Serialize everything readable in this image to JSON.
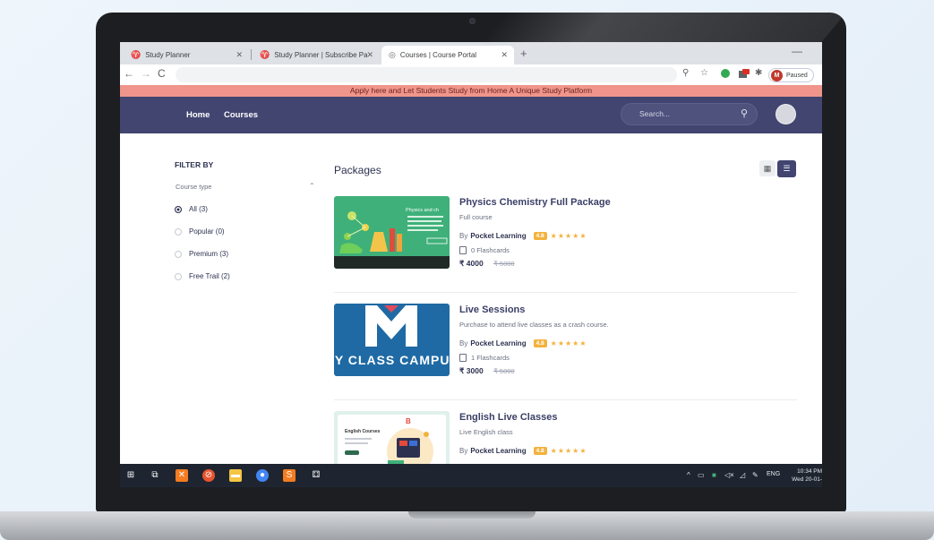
{
  "browser": {
    "tabs": [
      {
        "title": "Study Planner",
        "icon": "study-planner-icon"
      },
      {
        "title": "Study Planner | Subscribe Packag",
        "icon": "study-planner-icon"
      },
      {
        "title": "Courses | Course Portal",
        "icon": "globe-icon"
      }
    ],
    "profile": {
      "initial": "M",
      "status": "Paused"
    }
  },
  "site": {
    "announcement": "Apply here and Let Students Study from Home A Unique Study Platform",
    "nav": {
      "home": "Home",
      "courses": "Courses"
    },
    "search_placeholder": "Search..."
  },
  "filter": {
    "title": "FILTER BY",
    "group": "Course type",
    "options": [
      {
        "label": "All (3)",
        "selected": true
      },
      {
        "label": "Popular (0)",
        "selected": false
      },
      {
        "label": "Premium (3)",
        "selected": false
      },
      {
        "label": "Free Trail (2)",
        "selected": false
      }
    ]
  },
  "packages": {
    "title": "Packages",
    "items": [
      {
        "title": "Physics Chemistry Full Package",
        "subtitle": "Full course",
        "by": "By",
        "author": "Pocket Learning",
        "rating": "4.8",
        "flashcards": "0 Flashcards",
        "price": "₹ 4000",
        "old_price": "₹ 5000",
        "thumb_text": "Physics and ch"
      },
      {
        "title": "Live Sessions",
        "subtitle": "Purchase to attend live classes as a crash course.",
        "by": "By",
        "author": "Pocket Learning",
        "rating": "4.8",
        "flashcards": "1 Flashcards",
        "price": "₹ 3000",
        "old_price": "₹ 5000",
        "thumb_text": "MY CLASS CAMPUS"
      },
      {
        "title": "English Live Classes",
        "subtitle": "Live English class",
        "by": "By",
        "author": "Pocket Learning",
        "rating": "4.8",
        "flashcards": "",
        "price": "",
        "old_price": "",
        "thumb_text": "English Courses"
      }
    ]
  },
  "taskbar": {
    "lang": "ENG",
    "time": "10:34 PM",
    "date": "Wed 20-01-"
  },
  "colors": {
    "nav": "#414570",
    "announce": "#f0958b",
    "accent": "#f3b23d"
  }
}
